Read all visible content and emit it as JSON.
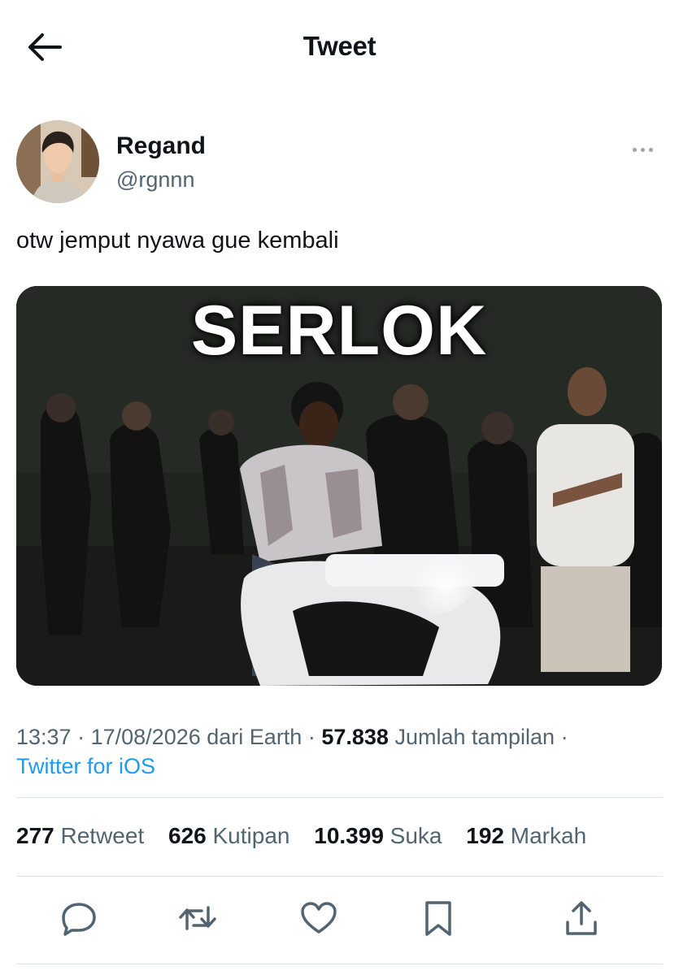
{
  "header": {
    "title": "Tweet",
    "back_icon": "arrow-left-icon"
  },
  "author": {
    "name": "Regand",
    "handle": "@rgnnn",
    "avatar": "profile-photo"
  },
  "tweet": {
    "text": "otw jemput nyawa gue kembali",
    "media": {
      "caption": "SERLOK",
      "description": "meme video still"
    }
  },
  "meta": {
    "time": "13:37",
    "sep1": "·",
    "date": "17/08/2026",
    "source_prefix": "dari Earth",
    "sep2": "·",
    "views": "57.838",
    "views_label": "Jumlah tampilan",
    "sep3": "·",
    "client": "Twitter for iOS"
  },
  "stats": [
    {
      "count": "277",
      "label": "Retweet"
    },
    {
      "count": "626",
      "label": "Kutipan"
    },
    {
      "count": "10.399",
      "label": "Suka"
    },
    {
      "count": "192",
      "label": "Markah"
    }
  ],
  "actions": [
    "reply-icon",
    "retweet-icon",
    "like-icon",
    "bookmark-icon",
    "share-icon"
  ],
  "colors": {
    "link": "#1d9bf0",
    "text": "#0f1419",
    "muted": "#536471",
    "icon": "#536471"
  }
}
